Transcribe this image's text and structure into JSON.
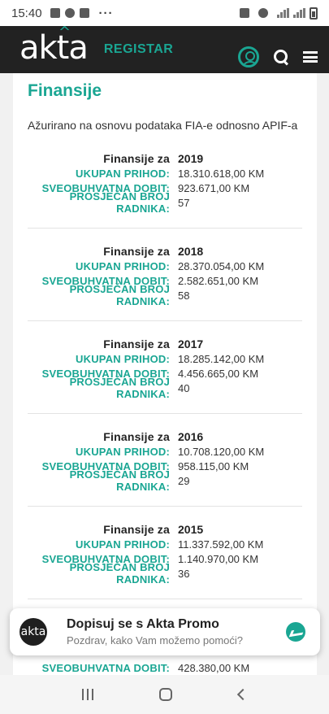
{
  "status_bar": {
    "time": "15:40",
    "dots": "···"
  },
  "header": {
    "logo": "akta",
    "register": "REGISTAR"
  },
  "page": {
    "title": "Finansije",
    "updated_note": "Ažurirano na osnovu podataka FIA-e odnosno APIF-a"
  },
  "labels": {
    "year": "Finansije za",
    "revenue": "UKUPAN PRIHOD:",
    "profit": "SVEOBUHVATNA DOBIT:",
    "employees": "PROSJEČAN BROJ RADNIKA:"
  },
  "finances": [
    {
      "year": "2019",
      "revenue": "18.310.618,00 KM",
      "profit": "923.671,00 KM",
      "employees": "57"
    },
    {
      "year": "2018",
      "revenue": "28.370.054,00 KM",
      "profit": "2.582.651,00 KM",
      "employees": "58"
    },
    {
      "year": "2017",
      "revenue": "18.285.142,00 KM",
      "profit": "4.456.665,00 KM",
      "employees": "40"
    },
    {
      "year": "2016",
      "revenue": "10.708.120,00 KM",
      "profit": "958.115,00 KM",
      "employees": "29"
    },
    {
      "year": "2015",
      "revenue": "11.337.592,00 KM",
      "profit": "1.140.970,00 KM",
      "employees": "36"
    }
  ],
  "partial_row": {
    "label": "SVEOBUHVATNA DOBIT:",
    "value": "428.380,00 KM"
  },
  "chat": {
    "avatar_text": "akta",
    "title": "Dopisuj se s Akta Promo",
    "subtitle": "Pozdrav, kako Vam možemo pomoći?"
  },
  "colors": {
    "accent": "#1aa693",
    "header_bg": "#222222"
  }
}
